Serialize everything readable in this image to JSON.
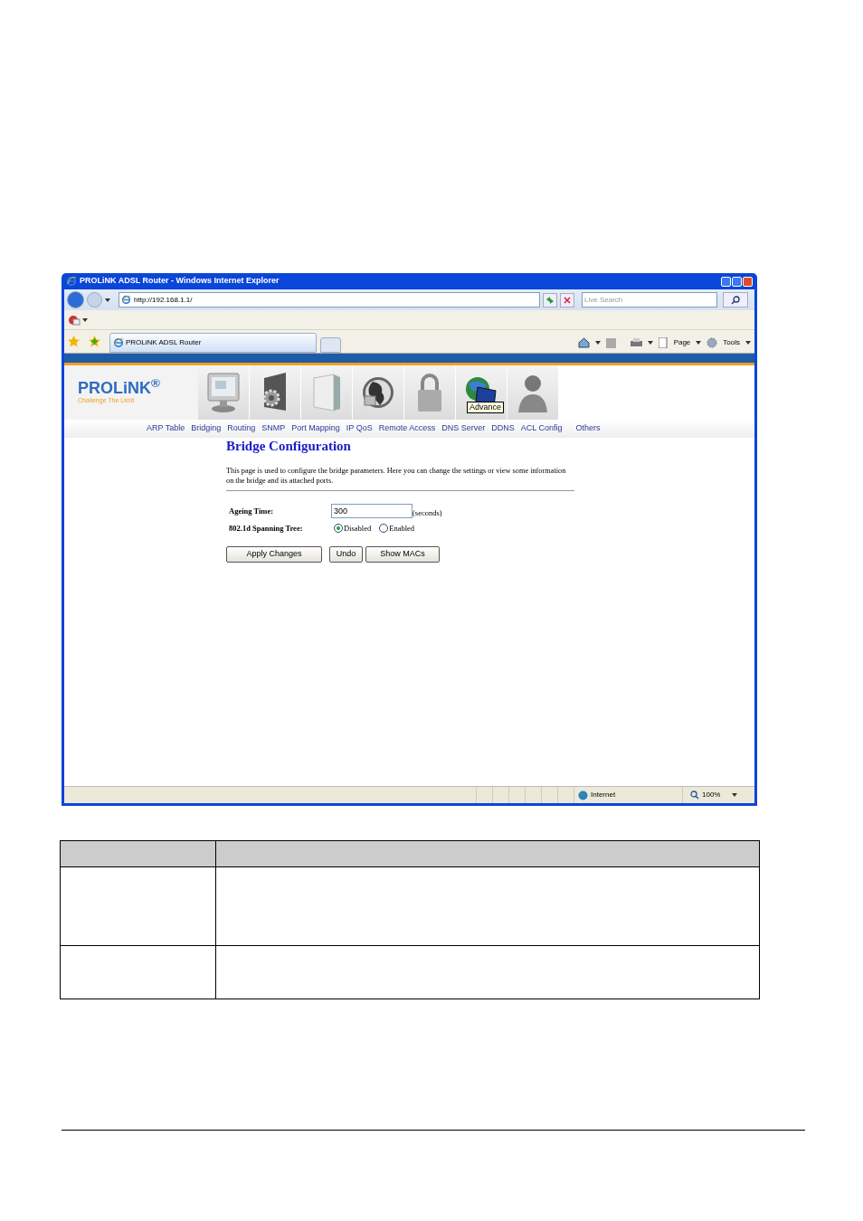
{
  "window": {
    "title": "PROLiNK ADSL Router - Windows Internet Explorer"
  },
  "address_bar": {
    "url": "http://192.168.1.1/"
  },
  "search": {
    "placeholder": "Live Search"
  },
  "browser_tab": {
    "title": "PROLiNK ADSL Router"
  },
  "command_bar": [
    "Page",
    "Tools"
  ],
  "router": {
    "logo": "PROLiNK$^{®}$",
    "tagline": "Challenge The Limit",
    "tooltip": "Advance",
    "nav_links": [
      "ARP Table",
      "Bridging",
      "Routing",
      "SNMP",
      "Port Mapping",
      "IP QoS",
      "Remote Access",
      "DNS Server",
      "DDNS",
      "ACL Config",
      "Others"
    ]
  },
  "page": {
    "heading": "Bridge Configuration",
    "description": "This page is used to configure the bridge parameters. Here you can change the settings or view some information on the bridge and its attached ports.",
    "ageing_time": {
      "label": "Ageing Time:",
      "value": "300",
      "unit": "(seconds)"
    },
    "spanning_tree": {
      "label": "802.1d Spanning Tree:",
      "options": [
        {
          "label": "Disabled",
          "selected": true
        },
        {
          "label": "Enabled",
          "selected": false
        }
      ]
    },
    "buttons": [
      "Apply Changes",
      "Undo",
      "Show MACs"
    ]
  },
  "status_bar": {
    "zone": "Internet",
    "zoom": "100%"
  }
}
